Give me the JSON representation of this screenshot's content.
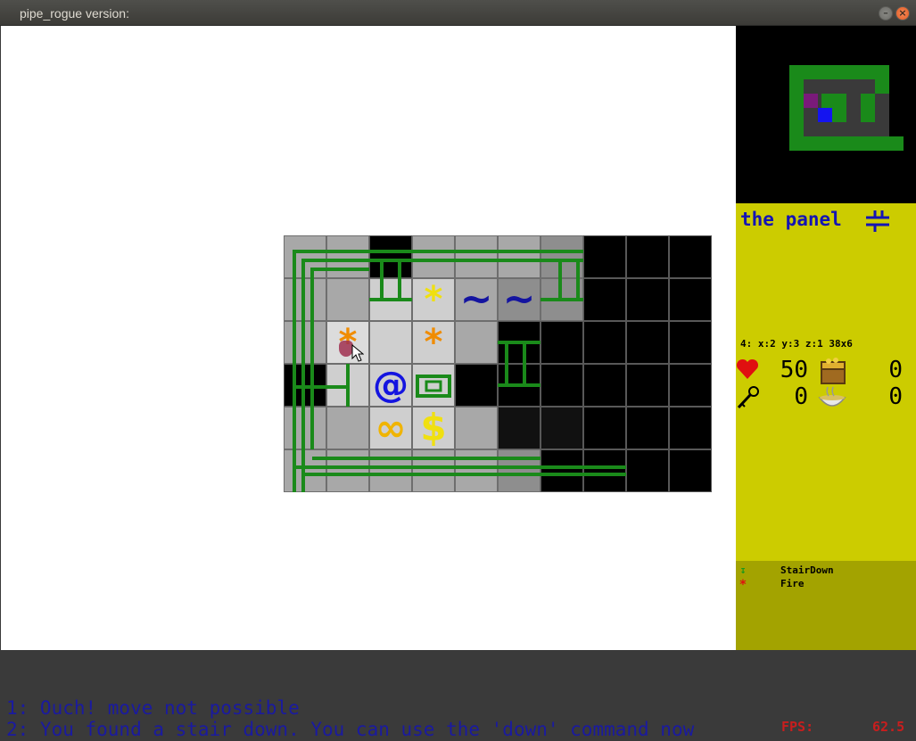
{
  "window": {
    "title": "pipe_rogue version:"
  },
  "map": {
    "glyphs": {
      "star": "*",
      "tilde": "~",
      "at": "@",
      "infinity": "∞",
      "dollar": "$"
    }
  },
  "panel": {
    "title": "the panel",
    "coords": "4: x:2 y:3 z:1 38x6",
    "stats": {
      "health": "50",
      "treasure": "0",
      "keys": "0",
      "food": "0"
    }
  },
  "legend": [
    {
      "icon": "stair-down-icon",
      "glyph": "↧",
      "color": "#1a9a1a",
      "label": "StairDown"
    },
    {
      "icon": "fire-icon",
      "glyph": "*",
      "color": "#e01010",
      "label": "Fire"
    }
  ],
  "log": {
    "messages": [
      "1: Ouch! move not possible",
      "2: You found a stair down. You can use the 'down' command now"
    ],
    "fps_label": "FPS:",
    "fps_value": "62.5"
  },
  "colors": {
    "panel_bg": "#cccc00",
    "legend_bg": "#a3a300",
    "pipe_green": "#1a8a1a",
    "text_blue": "#1414b4"
  }
}
